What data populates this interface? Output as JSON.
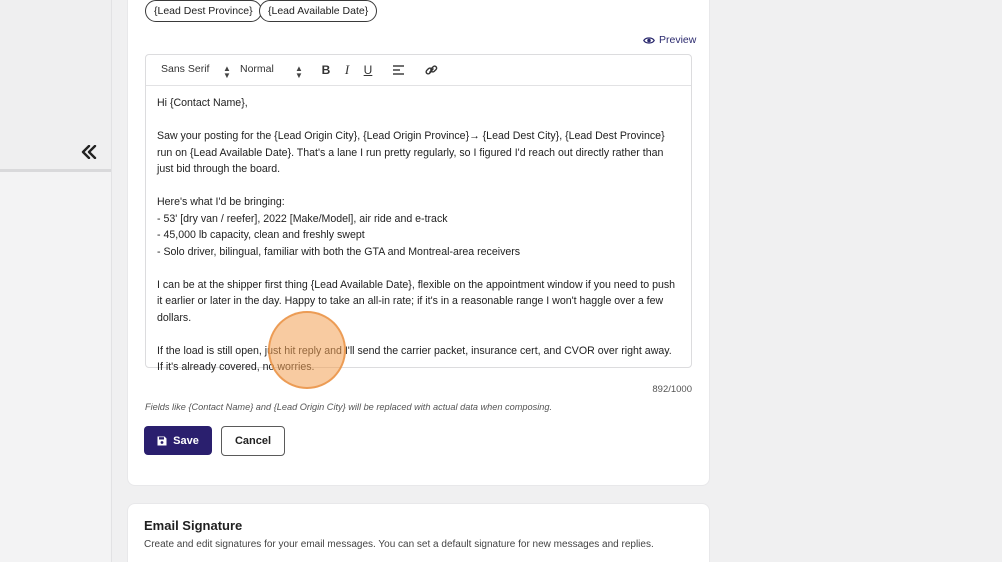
{
  "chips": [
    {
      "label": "{Lead Dest Province}"
    },
    {
      "label": "{Lead Available Date}"
    }
  ],
  "preview_label": "Preview",
  "toolbar": {
    "font_select": "Sans Serif",
    "size_select": "Normal",
    "bold": "B",
    "italic": "I",
    "underline": "U"
  },
  "body": {
    "greeting": "Hi {Contact Name},",
    "para1": "Saw your posting for the {Lead Origin City}, {Lead Origin Province}→ {Lead Dest City}, {Lead Dest Province} run on {Lead Available Date}. That's a lane I run pretty regularly, so I figured I'd reach out directly rather than just bid through the board.",
    "bring_intro": "Here's what I'd be bringing:",
    "bring_items": [
      "- 53' [dry van / reefer], 2022 [Make/Model], air ride and e-track",
      "- 45,000 lb capacity, clean and freshly swept",
      "- Solo driver, bilingual, familiar with both the GTA and Montreal-area receivers"
    ],
    "para3": "I can be at the shipper first thing {Lead Available Date}, flexible on the appointment window if you need to push it earlier or later in the day. Happy to take an all-in rate; if it's in a reasonable range I won't haggle over a few dollars.",
    "para4": "If the load is still open, just hit reply and I'll send the carrier packet, insurance cert, and CVOR over right away. If it's already covered, no worries."
  },
  "char_counter": "892/1000",
  "hint_text": "Fields like {Contact Name} and {Lead Origin City} will be replaced with actual data when composing.",
  "buttons": {
    "save": "Save",
    "cancel": "Cancel"
  },
  "signature": {
    "title": "Email Signature",
    "description": "Create and edit signatures for your email messages. You can set a default signature for new messages and replies."
  },
  "colors": {
    "primary": "#2a1f6e",
    "cursor_highlight": "#f3a054"
  }
}
